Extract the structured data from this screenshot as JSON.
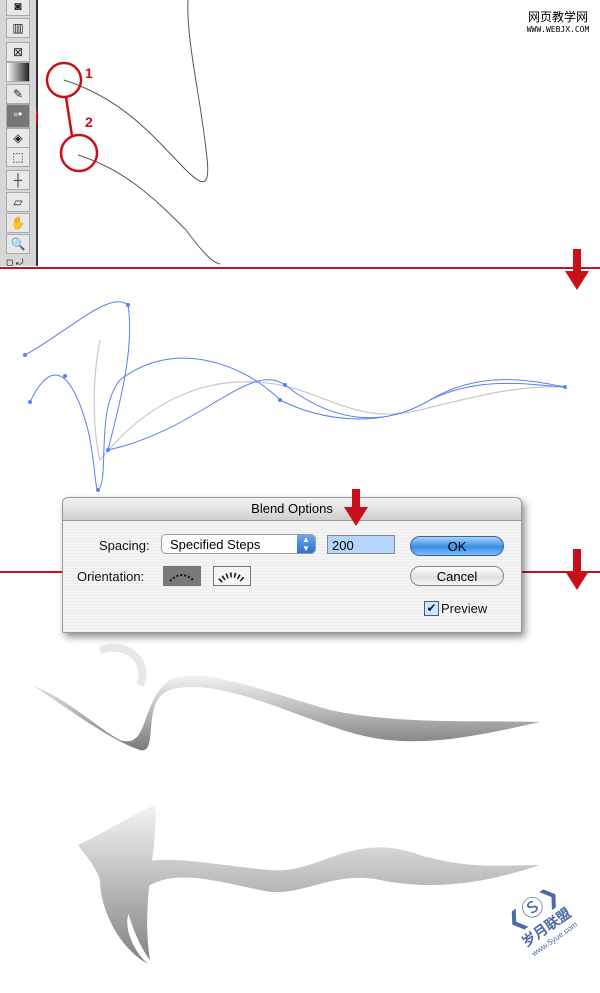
{
  "watermark_top": {
    "line1": "网页教学网",
    "line2": "WWW.WEBJX.COM"
  },
  "watermark_bottom": {
    "line1": "岁月联盟",
    "line2": "www.5yue.com"
  },
  "toolbar": {
    "tools": [
      "symbol-sprayer",
      "graph",
      "mesh",
      "gradient",
      "eyedropper",
      "blend",
      "live-paint",
      "live-paint-select",
      "slice",
      "eraser",
      "hand",
      "zoom"
    ],
    "selected": "blend"
  },
  "callouts": {
    "point1": "1",
    "point2": "2"
  },
  "colors": {
    "accent_red": "#c8101a",
    "path_blue": "#5a7ff0"
  },
  "dialog": {
    "title": "Blend Options",
    "spacing_label": "Spacing:",
    "spacing_value": "Specified Steps",
    "steps_value": "200",
    "orientation_label": "Orientation:",
    "ok_label": "OK",
    "cancel_label": "Cancel",
    "preview_label": "Preview",
    "preview_checked": true
  }
}
